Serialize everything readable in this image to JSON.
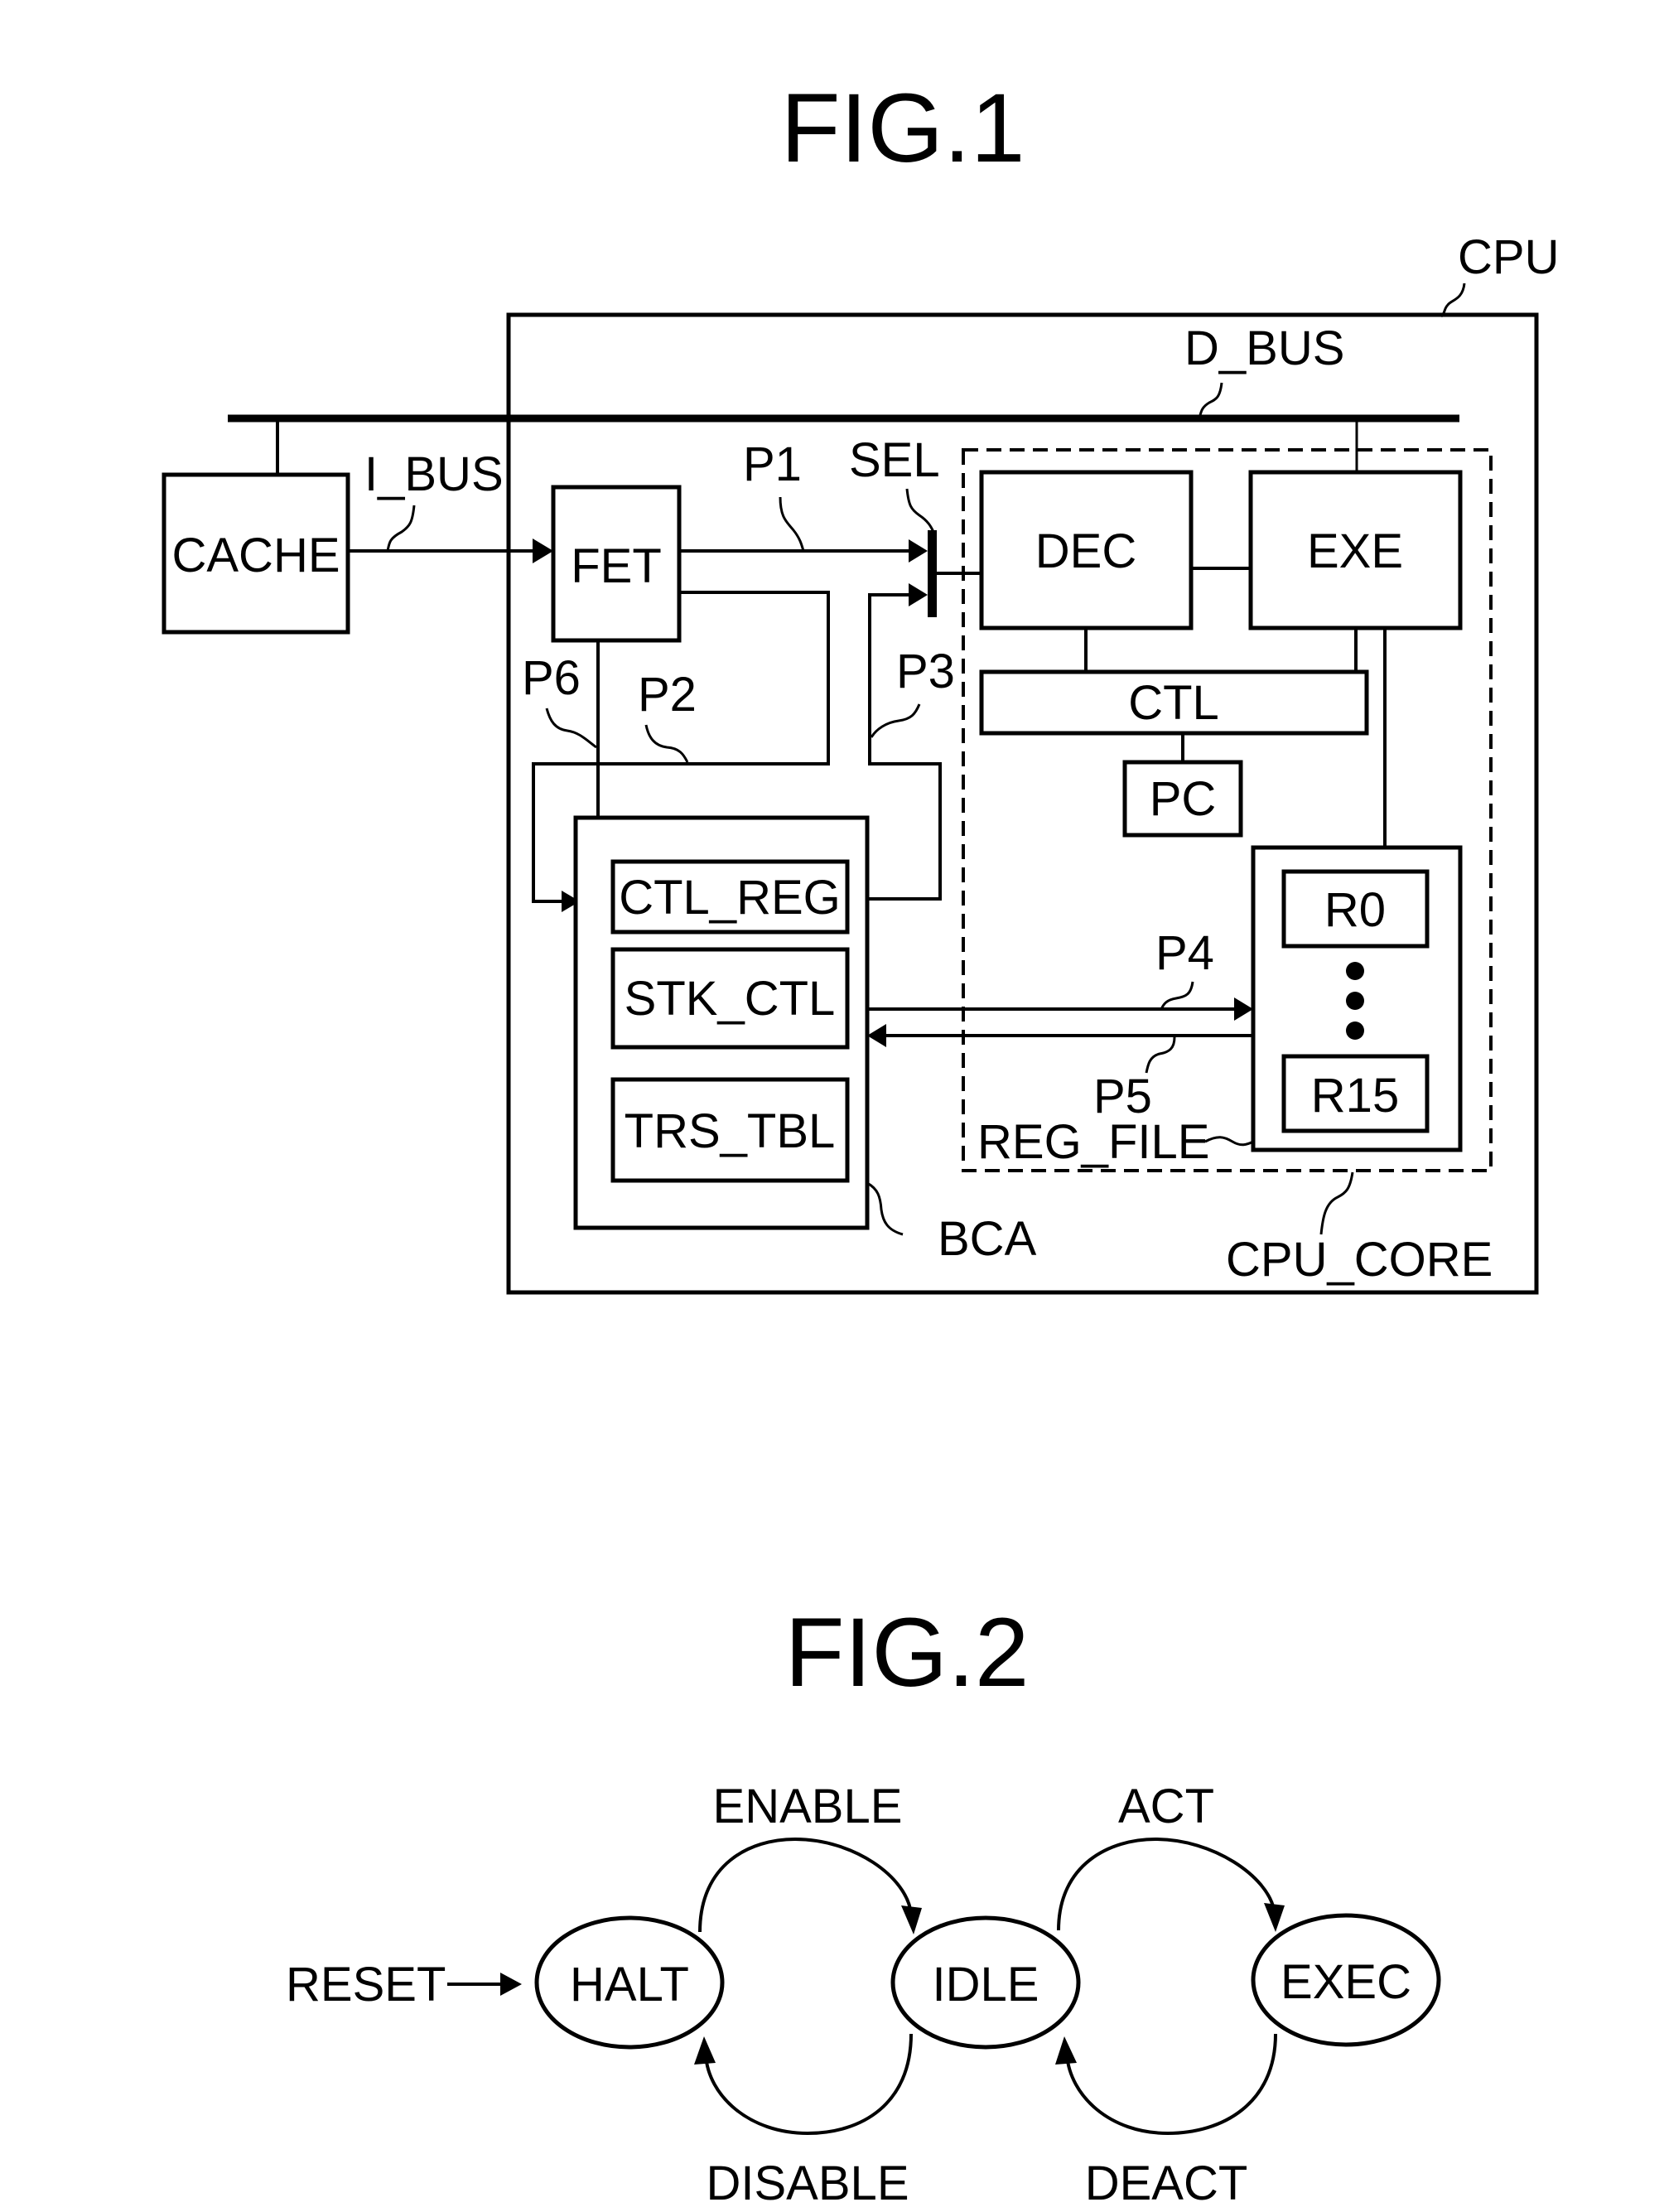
{
  "fig1": {
    "title": "FIG.1",
    "labels": {
      "cpu": "CPU",
      "d_bus": "D_BUS",
      "i_bus": "I_BUS",
      "p1": "P1",
      "sel": "SEL",
      "p2": "P2",
      "p3": "P3",
      "p4": "P4",
      "p5": "P5",
      "p6": "P6",
      "bca": "BCA",
      "reg_file": "REG_FILE",
      "cpu_core": "CPU_CORE"
    },
    "blocks": {
      "cache": "CACHE",
      "fet": "FET",
      "dec": "DEC",
      "exe": "EXE",
      "ctl": "CTL",
      "pc": "PC",
      "ctl_reg": "CTL_REG",
      "stk_ctl": "STK_CTL",
      "trs_tbl": "TRS_TBL",
      "r0": "R0",
      "r15": "R15"
    }
  },
  "fig2": {
    "title": "FIG.2",
    "states": [
      "HALT",
      "IDLE",
      "EXEC"
    ],
    "reset": "RESET",
    "transitions": {
      "enable": "ENABLE",
      "disable": "DISABLE",
      "act": "ACT",
      "deact": "DEACT"
    }
  }
}
